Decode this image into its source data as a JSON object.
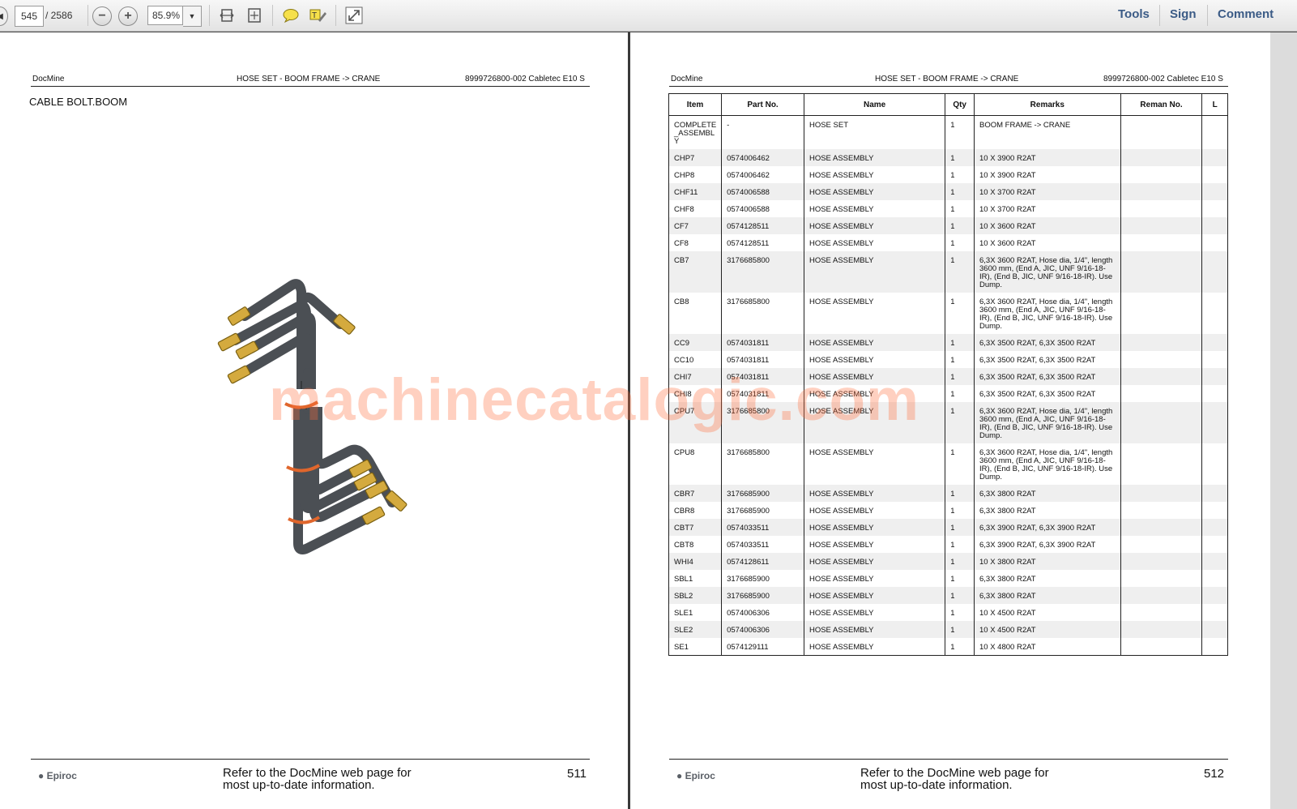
{
  "toolbar": {
    "page_current": "545",
    "page_total": "/ 2586",
    "zoom": "85.9%",
    "zoom_out_icon": "minus",
    "zoom_in_icon": "plus",
    "links": [
      "Tools",
      "Sign",
      "Comment"
    ]
  },
  "left_page": {
    "header_left": "DocMine",
    "header_center": "HOSE SET - BOOM FRAME -> CRANE",
    "header_right": "8999726800-002 Cabletec E10 S",
    "section_title": "CABLE BOLT.BOOM",
    "footer_logo": "Epiroc",
    "footer_text": "Refer to the DocMine web page for most up-to-date information.",
    "page_number": "511"
  },
  "right_page": {
    "header_left": "DocMine",
    "header_center": "HOSE SET - BOOM FRAME -> CRANE",
    "header_right": "8999726800-002 Cabletec E10 S",
    "footer_logo": "Epiroc",
    "footer_text": "Refer to the DocMine web page for most up-to-date information.",
    "page_number": "512",
    "table": {
      "headers": [
        "Item",
        "Part No.",
        "Name",
        "Qty",
        "Remarks",
        "Reman No.",
        "L"
      ],
      "rows": [
        [
          "COMPLETE_ASSEMBLY",
          "-",
          "HOSE SET",
          "1",
          "BOOM FRAME -> CRANE",
          "",
          ""
        ],
        [
          "CHP7",
          "0574006462",
          "HOSE ASSEMBLY",
          "1",
          "10 X 3900 R2AT",
          "",
          ""
        ],
        [
          "CHP8",
          "0574006462",
          "HOSE ASSEMBLY",
          "1",
          "10 X 3900 R2AT",
          "",
          ""
        ],
        [
          "CHF11",
          "0574006588",
          "HOSE ASSEMBLY",
          "1",
          "10 X 3700 R2AT",
          "",
          ""
        ],
        [
          "CHF8",
          "0574006588",
          "HOSE ASSEMBLY",
          "1",
          "10 X 3700 R2AT",
          "",
          ""
        ],
        [
          "CF7",
          "0574128511",
          "HOSE ASSEMBLY",
          "1",
          "10 X 3600 R2AT",
          "",
          ""
        ],
        [
          "CF8",
          "0574128511",
          "HOSE ASSEMBLY",
          "1",
          "10 X 3600 R2AT",
          "",
          ""
        ],
        [
          "CB7",
          "3176685800",
          "HOSE ASSEMBLY",
          "1",
          "6,3X 3600 R2AT, Hose dia, 1/4\", length 3600 mm, (End A, JIC, UNF 9/16-18-IR), (End B, JIC, UNF 9/16-18-IR). Use Dump.",
          "",
          ""
        ],
        [
          "CB8",
          "3176685800",
          "HOSE ASSEMBLY",
          "1",
          "6,3X 3600 R2AT, Hose dia, 1/4\", length 3600 mm, (End A, JIC, UNF 9/16-18-IR), (End B, JIC, UNF 9/16-18-IR). Use Dump.",
          "",
          ""
        ],
        [
          "CC9",
          "0574031811",
          "HOSE ASSEMBLY",
          "1",
          "6,3X 3500 R2AT,  6,3X 3500 R2AT",
          "",
          ""
        ],
        [
          "CC10",
          "0574031811",
          "HOSE ASSEMBLY",
          "1",
          "6,3X 3500 R2AT,  6,3X 3500 R2AT",
          "",
          ""
        ],
        [
          "CHI7",
          "0574031811",
          "HOSE ASSEMBLY",
          "1",
          "6,3X 3500 R2AT,  6,3X 3500 R2AT",
          "",
          ""
        ],
        [
          "CHI8",
          "0574031811",
          "HOSE ASSEMBLY",
          "1",
          "6,3X 3500 R2AT,  6,3X 3500 R2AT",
          "",
          ""
        ],
        [
          "CPU7",
          "3176685800",
          "HOSE ASSEMBLY",
          "1",
          "6,3X 3600 R2AT, Hose dia, 1/4\", length 3600 mm, (End A, JIC, UNF 9/16-18-IR), (End B, JIC, UNF 9/16-18-IR). Use Dump.",
          "",
          ""
        ],
        [
          "CPU8",
          "3176685800",
          "HOSE ASSEMBLY",
          "1",
          "6,3X 3600 R2AT, Hose dia, 1/4\", length 3600 mm, (End A, JIC, UNF 9/16-18-IR), (End B, JIC, UNF 9/16-18-IR). Use Dump.",
          "",
          ""
        ],
        [
          "CBR7",
          "3176685900",
          "HOSE ASSEMBLY",
          "1",
          "6,3X 3800 R2AT",
          "",
          ""
        ],
        [
          "CBR8",
          "3176685900",
          "HOSE ASSEMBLY",
          "1",
          "6,3X 3800 R2AT",
          "",
          ""
        ],
        [
          "CBT7",
          "0574033511",
          "HOSE ASSEMBLY",
          "1",
          "6,3X 3900 R2AT, 6,3X 3900 R2AT",
          "",
          ""
        ],
        [
          "CBT8",
          "0574033511",
          "HOSE ASSEMBLY",
          "1",
          "6,3X 3900 R2AT, 6,3X 3900 R2AT",
          "",
          ""
        ],
        [
          "WHI4",
          "0574128611",
          "HOSE ASSEMBLY",
          "1",
          "10 X 3800 R2AT",
          "",
          ""
        ],
        [
          "SBL1",
          "3176685900",
          "HOSE ASSEMBLY",
          "1",
          "6,3X 3800 R2AT",
          "",
          ""
        ],
        [
          "SBL2",
          "3176685900",
          "HOSE ASSEMBLY",
          "1",
          "6,3X 3800 R2AT",
          "",
          ""
        ],
        [
          "SLE1",
          "0574006306",
          "HOSE ASSEMBLY",
          "1",
          "10 X 4500 R2AT",
          "",
          ""
        ],
        [
          "SLE2",
          "0574006306",
          "HOSE ASSEMBLY",
          "1",
          "10 X 4500 R2AT",
          "",
          ""
        ],
        [
          "SE1",
          "0574129111",
          "HOSE ASSEMBLY",
          "1",
          "10 X 4800 R2AT",
          "",
          ""
        ]
      ]
    }
  },
  "watermark": "machinecatalogic.com",
  "colors": {
    "hose": "#4b4f54",
    "fitting": "#c9a23a",
    "clamp": "#e0662c",
    "watermark": "#ff6e3c",
    "link": "#3b5b86"
  }
}
